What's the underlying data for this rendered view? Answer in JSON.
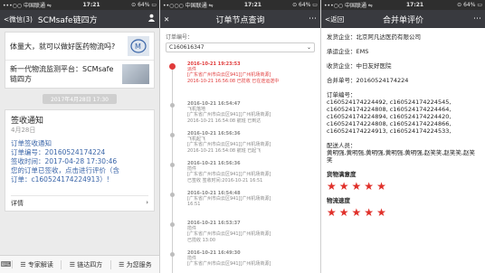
{
  "panel1": {
    "status": {
      "carrier": "•••○○ 中国联通 ⇋",
      "time": "17:21",
      "battery": "⊙ 64% ▭"
    },
    "nav": {
      "back": "<微信(3)",
      "title": "SCMsafe链四方",
      "right_icon": "person-icon"
    },
    "articles": [
      {
        "text": "体量大，就可以做好医药物流吗?"
      },
      {
        "text": "新一代物流监测平台：SCMsafe链四方"
      }
    ],
    "date_pill": "2017年4月28日 17:30",
    "notice": {
      "heading": "签收通知",
      "date": "4月28日",
      "lines": [
        "订单签收通知",
        "订单编号：20160524174224",
        "签收时间：2017-04-28 17:30:46",
        "您的订单已签收，点击进行评价（含",
        "订单：c160524174224913）!"
      ],
      "detail_label": "详情",
      "detail_arrow": "›"
    },
    "menu": [
      "☰ 专家解读",
      "☰ 链达四方",
      "☰ 为您服务"
    ]
  },
  "panel2": {
    "status": {
      "carrier": "••○○○ 中国联通 ⇋",
      "time": "17:21",
      "battery": "⊙ 64% ▭"
    },
    "nav": {
      "close": "✕",
      "title": "订单节点查询",
      "more": "⋯"
    },
    "label": "订单编号：",
    "order_input": "C160616347",
    "events": [
      {
        "time": "2016-10-21 19:23:53",
        "lines": [
          "派件",
          "[广东省广州市白云区941][广州机场商源]",
          "2016-10-21 16:56:08 已揽收 已在途运送中"
        ]
      },
      {
        "time": "2016-10-21 16:54:47",
        "lines": [
          "飞机落地",
          "[广东省广州市白云区941][广州机场商源]",
          "2016-10-21 16:54:08 航班 已到达"
        ]
      },
      {
        "time": "2016-10-21 16:56:36",
        "lines": [
          "飞机起飞",
          "[广东省广州市白云区941][广州机场商源]",
          "2016-10-21 16:54:08 航班 已起飞"
        ]
      },
      {
        "time": "2016-10-21 16:56:36",
        "lines": [
          "揽件",
          "[广东省广州市白云区941][广州机场商源]",
          "已签收 签收时间:2016-10-21 16:51"
        ]
      },
      {
        "time": "2016-10-21 16:54:48",
        "lines": [
          "[广东省广州市白云区941][广州机场商源]",
          "16:51"
        ]
      },
      {
        "time": "2016-10-21 16:53:37",
        "lines": [
          "揽件",
          "[广东省广州市白云区941][广州机场商源]",
          "已揽收 13:00"
        ]
      },
      {
        "time": "2016-10-21 16:49:30",
        "lines": [
          "揽件",
          "[广东省广州市白云区941][广州机场商源]"
        ]
      }
    ]
  },
  "panel3": {
    "status": {
      "carrier": "•••○○ 中国联通 ⇋",
      "time": "17:21",
      "battery": "⊙ 64% ▭"
    },
    "nav": {
      "back": "<返回",
      "title": "合并单评价",
      "more": "⋯"
    },
    "sender": "发货企业：北京阿凡达医药有限公司",
    "carrier": "承运企业：EMS",
    "receiver": "收货企业：中日友好医院",
    "order_no": "合并单号：20160524174224",
    "order_label": "订单编号：",
    "orders": "c160524174224492, c160524174224545, c160524174224808, c160524174224464, c160524174224894, c160524174224420, c160524174224808, c160524174224866, c160524174224913, c160524174224533,",
    "courier_label": "配送人员：",
    "couriers": "黄明强,黄明强,黄明强,黄明强,黄明强,赵笑笑,赵笑笑,赵笑笑",
    "rating1_label": "货物满意度",
    "rating1": 5,
    "rating2_label": "物流速度",
    "rating2": 5,
    "star_color": "#e0302a"
  }
}
